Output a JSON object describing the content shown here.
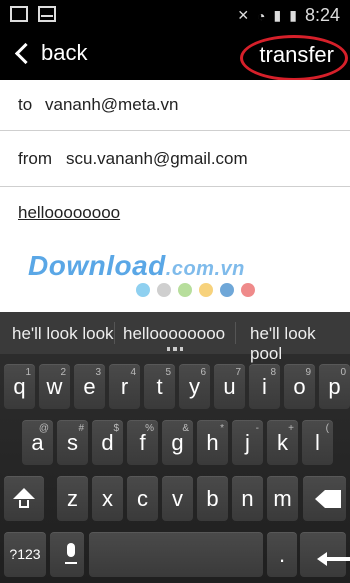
{
  "status": {
    "time": "8:24"
  },
  "app": {
    "back_label": "back",
    "transfer_label": "transfer"
  },
  "form": {
    "to_label": "to",
    "to_value": "vananh@meta.vn",
    "from_label": "from",
    "from_value": "scu.vananh@gmail.com",
    "body_text": "helloooooooo"
  },
  "watermark": {
    "text": "Download",
    "sub": ".com.vn"
  },
  "keyboard": {
    "suggestions": [
      "he'll look look",
      "helloooooooo",
      "he'll look pool"
    ],
    "row1": [
      "q",
      "w",
      "e",
      "r",
      "t",
      "y",
      "u",
      "i",
      "o",
      "p"
    ],
    "row1_hints": [
      "1",
      "2",
      "3",
      "4",
      "5",
      "6",
      "7",
      "8",
      "9",
      "0"
    ],
    "row2": [
      "a",
      "s",
      "d",
      "f",
      "g",
      "h",
      "j",
      "k",
      "l"
    ],
    "row2_hints": [
      "@",
      "#",
      "$",
      "%",
      "&",
      "*",
      "-",
      "+",
      "("
    ],
    "row3": [
      "z",
      "x",
      "c",
      "v",
      "b",
      "n",
      "m"
    ],
    "row3_hints": [
      "",
      "",
      "",
      "",
      "",
      "",
      ""
    ],
    "sym_label": "?123",
    "period_label": "."
  },
  "colors": {
    "accent_circle": "#d6202a",
    "watermark": "#5aa7e6"
  },
  "watermark_dots": [
    "#8fd0f0",
    "#cfcfcf",
    "#b7de9c",
    "#f7d27c",
    "#6fa7d8",
    "#ef8a8a"
  ]
}
